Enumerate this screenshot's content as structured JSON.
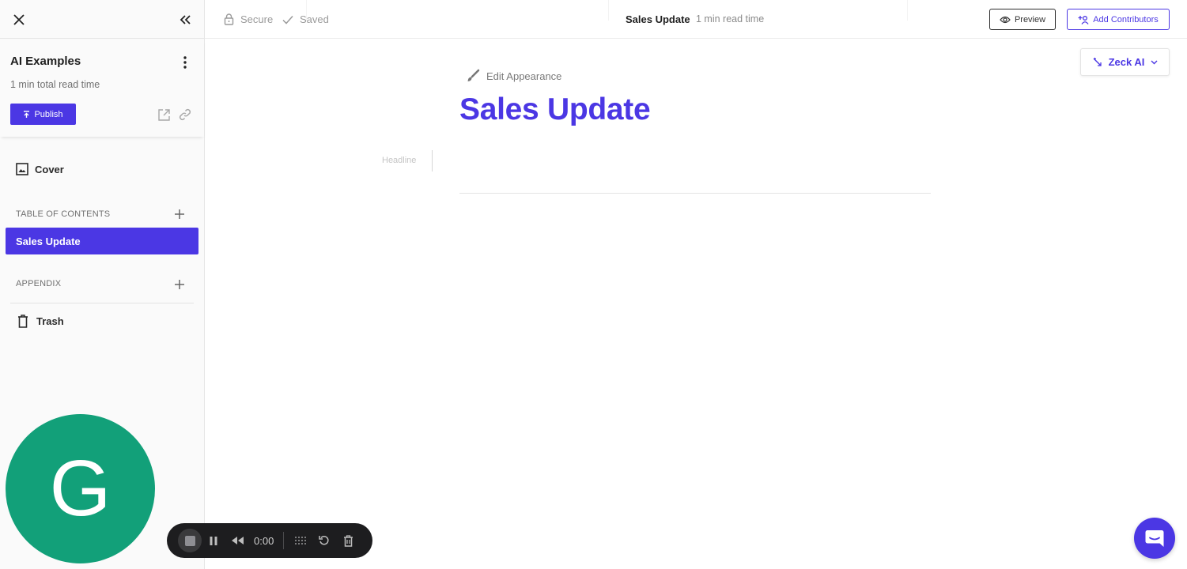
{
  "sidebar": {
    "doc_title": "AI Examples",
    "total_read_time": "1 min total read time",
    "publish_label": "Publish",
    "cover_label": "Cover",
    "toc_label": "TABLE OF CONTENTS",
    "toc_items": [
      "Sales Update"
    ],
    "appendix_label": "APPENDIX",
    "trash_label": "Trash",
    "avatar_initial": "G"
  },
  "recorder": {
    "time": "0:00"
  },
  "topbar": {
    "secure_label": "Secure",
    "saved_label": "Saved",
    "title": "Sales Update",
    "read_time": "1 min read time",
    "preview_label": "Preview",
    "contributors_label": "Add Contributors"
  },
  "main": {
    "zeck_ai_label": "Zeck AI",
    "edit_appearance_label": "Edit Appearance",
    "section_title": "Sales Update",
    "headline_placeholder": "Headline"
  },
  "colors": {
    "accent": "#4b37e4",
    "avatar": "#12a079",
    "recorder_bg": "#1d1d1f"
  }
}
